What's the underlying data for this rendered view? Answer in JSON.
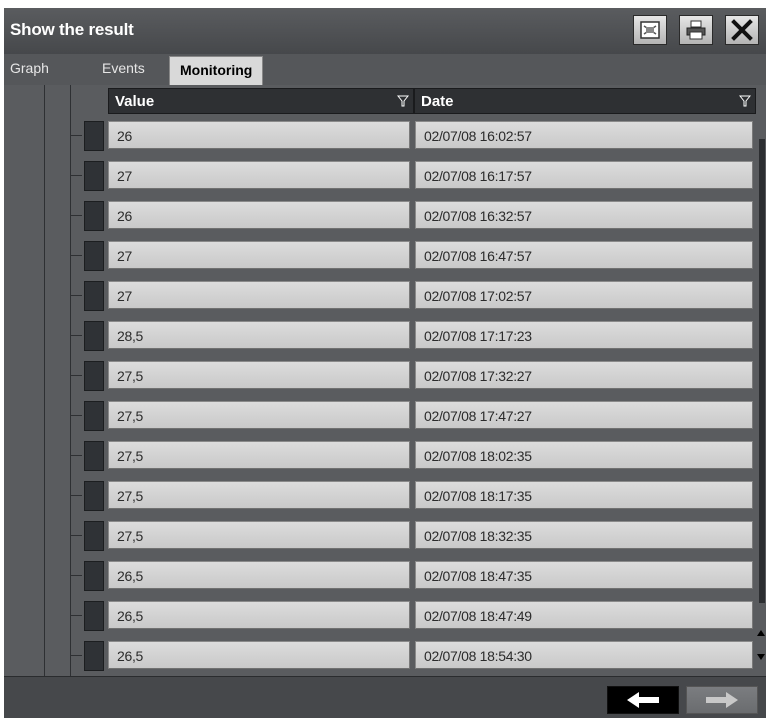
{
  "window": {
    "title": "Show the result",
    "toolbar": {
      "export_icon": "export-image-icon",
      "print_icon": "printer-icon",
      "close_icon": "close-icon"
    }
  },
  "tabs": [
    {
      "label": "Graph",
      "active": false
    },
    {
      "label": "Events",
      "active": false
    },
    {
      "label": "Monitoring",
      "active": true
    }
  ],
  "table": {
    "columns": [
      {
        "label": "Value",
        "filter_icon": "filter-icon"
      },
      {
        "label": "Date",
        "filter_icon": "filter-icon"
      }
    ],
    "rows": [
      {
        "value": "26",
        "date": "02/07/08 16:02:57"
      },
      {
        "value": "27",
        "date": "02/07/08 16:17:57"
      },
      {
        "value": "26",
        "date": "02/07/08 16:32:57"
      },
      {
        "value": "27",
        "date": "02/07/08 16:47:57"
      },
      {
        "value": "27",
        "date": "02/07/08 17:02:57"
      },
      {
        "value": "28,5",
        "date": "02/07/08 17:17:23"
      },
      {
        "value": "27,5",
        "date": "02/07/08 17:32:27"
      },
      {
        "value": "27,5",
        "date": "02/07/08 17:47:27"
      },
      {
        "value": "27,5",
        "date": "02/07/08 18:02:35"
      },
      {
        "value": "27,5",
        "date": "02/07/08 18:17:35"
      },
      {
        "value": "27,5",
        "date": "02/07/08 18:32:35"
      },
      {
        "value": "26,5",
        "date": "02/07/08 18:47:35"
      },
      {
        "value": "26,5",
        "date": "02/07/08 18:47:49"
      },
      {
        "value": "26,5",
        "date": "02/07/08 18:54:30"
      }
    ]
  },
  "navigation": {
    "prev_icon": "arrow-left-icon",
    "next_icon": "arrow-right-icon",
    "next_enabled": false
  },
  "colors": {
    "window_bg": "#4a4c4f",
    "header_bg": "#2e3033",
    "cell_bg": "#d4d4d4",
    "active_tab_bg": "#d9d9d9"
  }
}
